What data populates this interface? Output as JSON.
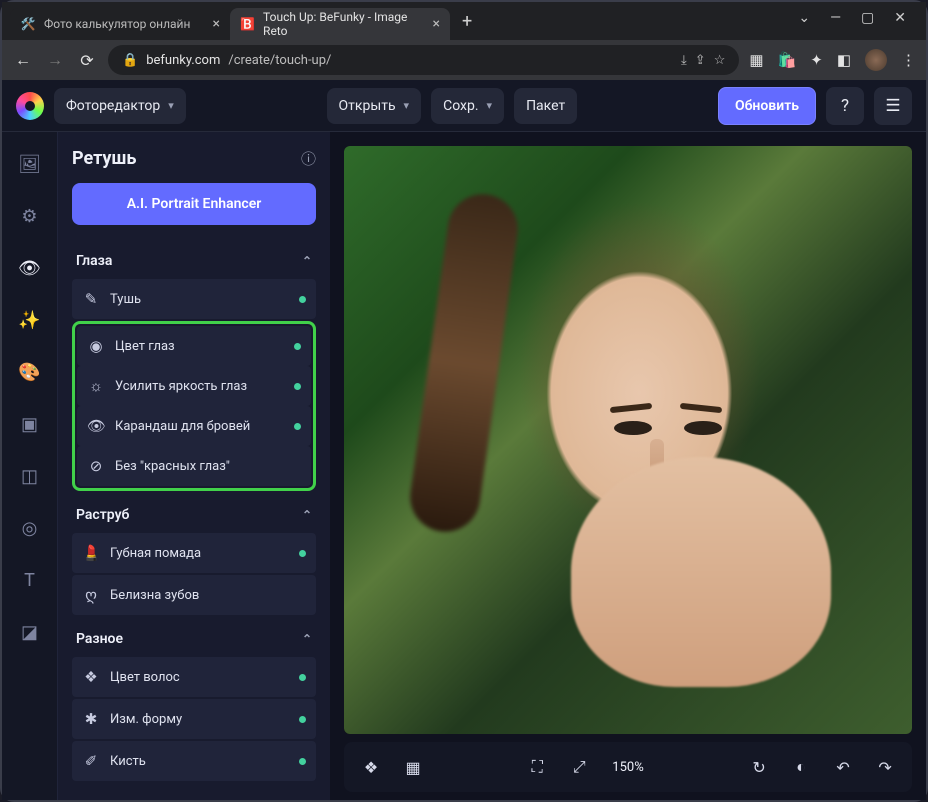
{
  "browser": {
    "tabs": [
      {
        "title": "Фото калькулятор онлайн",
        "active": false
      },
      {
        "title": "Touch Up: BeFunky - Image Reto",
        "active": true
      }
    ],
    "url_host": "befunky.com",
    "url_path": "/create/touch-up/"
  },
  "appbar": {
    "editor_label": "Фоторедактор",
    "open_label": "Открыть",
    "save_label": "Сохр.",
    "batch_label": "Пакет",
    "update_label": "Обновить"
  },
  "panel": {
    "title": "Ретушь",
    "ai_button": "A.I. Portrait Enhancer",
    "sections": [
      {
        "title": "Глаза",
        "highlighted_group": true,
        "tools_before": [
          {
            "label": "Тушь",
            "icon": "mascara",
            "dot": true
          }
        ],
        "tools_hl": [
          {
            "label": "Цвет глаз",
            "icon": "eye-color",
            "dot": true
          },
          {
            "label": "Усилить яркость глаз",
            "icon": "brightness",
            "dot": true
          },
          {
            "label": "Карандаш для бровей",
            "icon": "eyebrow",
            "dot": true
          },
          {
            "label": "Без \"красных глаз\"",
            "icon": "no-red-eye",
            "dot": false
          }
        ]
      },
      {
        "title": "Раструб",
        "tools": [
          {
            "label": "Губная помада",
            "icon": "lipstick",
            "dot": true
          },
          {
            "label": "Белизна зубов",
            "icon": "teeth",
            "dot": false
          }
        ]
      },
      {
        "title": "Разное",
        "tools": [
          {
            "label": "Цвет волос",
            "icon": "hair",
            "dot": true
          },
          {
            "label": "Изм. форму",
            "icon": "reshape",
            "dot": true
          },
          {
            "label": "Кисть",
            "icon": "brush",
            "dot": true
          }
        ]
      }
    ]
  },
  "bottombar": {
    "zoom": "150%"
  }
}
